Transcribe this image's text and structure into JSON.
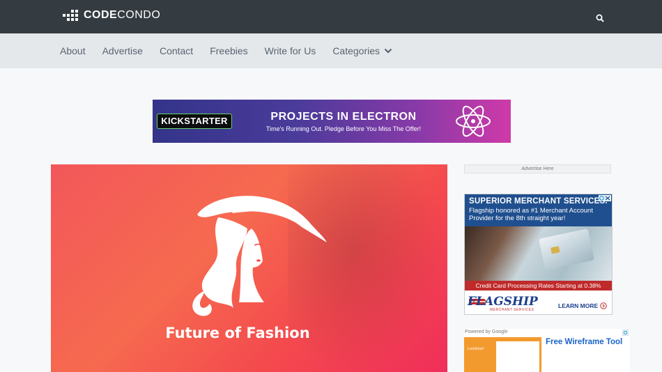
{
  "header": {
    "logo_bold": "CODE",
    "logo_light": "CONDO",
    "search_icon": "search-icon"
  },
  "nav": {
    "items": [
      "About",
      "Advertise",
      "Contact",
      "Freebies",
      "Write for Us",
      "Categories"
    ],
    "dropdown_icon": "chevron-down-icon"
  },
  "banner": {
    "badge": "KICKSTARTER",
    "title": "PROJECTS IN ELECTRON",
    "subtitle": "Time's Running Out. Pledge Before You Miss The Offer!",
    "icon": "atom-icon"
  },
  "hero": {
    "title": "Future of Fashion",
    "logo_icon": "woman-hat-icon"
  },
  "sidebar": {
    "ad_label": "Advertise Here",
    "merchant_ad": {
      "headline": "SUPERIOR MERCHANT SERVICES.",
      "body": "Flagship honored as #1 Merchant Account Provider for the 8th straight year!",
      "strip": "Credit Card Processing Rates Starting at 0.38%",
      "brand": "FLAGSHIP",
      "brand_sub": "MERCHANT SERVICES",
      "cta": "LEARN MORE"
    },
    "google_ad": {
      "powered_by": "Powered by Google",
      "title": "Free Wireframe Tool",
      "thumb_text": "Lucidchart"
    }
  },
  "colors": {
    "topbar": "#343c42",
    "navbar": "#e5e8eb",
    "nav_text": "#586470",
    "hero": "#f4484e",
    "ad_blue": "#1f4f8e",
    "ad_red": "#c02a2a"
  }
}
